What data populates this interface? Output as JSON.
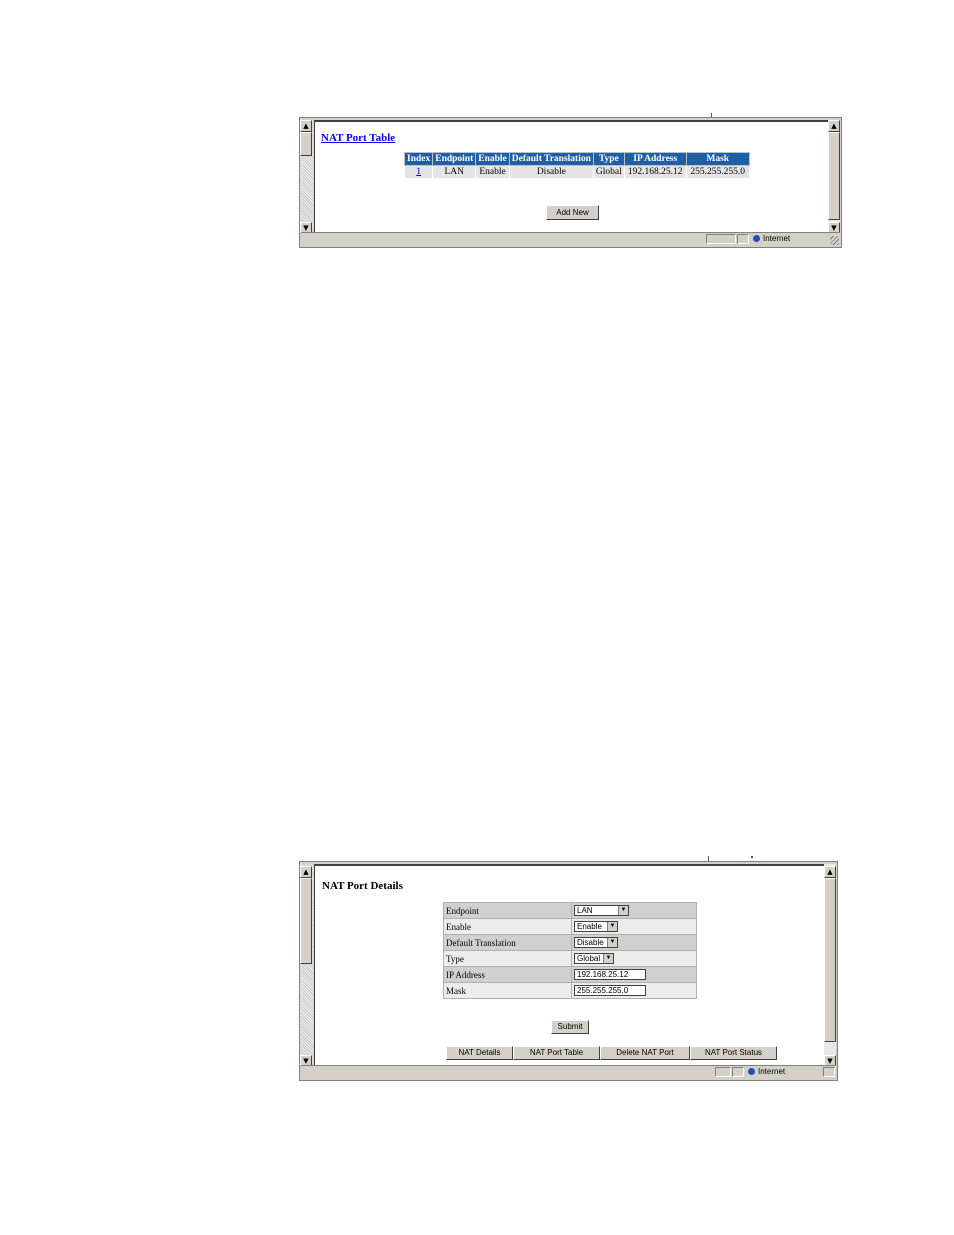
{
  "port_table": {
    "title": "NAT Port Table",
    "columns": [
      "Index",
      "Endpoint",
      "Enable",
      "Default Translation",
      "Type",
      "IP Address",
      "Mask"
    ],
    "rows": [
      {
        "index": "1",
        "endpoint": "LAN",
        "enable": "Enable",
        "default_translation": "Disable",
        "type": "Global",
        "ip_address": "192.168.25.12",
        "mask": "255.255.255.0"
      }
    ],
    "add_new_label": "Add New",
    "status_zone": "Internet"
  },
  "port_details": {
    "title": "NAT Port Details",
    "fields": {
      "endpoint": {
        "label": "Endpoint",
        "value": "LAN"
      },
      "enable": {
        "label": "Enable",
        "value": "Enable"
      },
      "default_translation": {
        "label": "Default Translation",
        "value": "Disable"
      },
      "type": {
        "label": "Type",
        "value": "Global"
      },
      "ip_address": {
        "label": "IP Address",
        "value": "192.168.25.12"
      },
      "mask": {
        "label": "Mask",
        "value": "255.255.255.0"
      }
    },
    "submit_label": "Submit",
    "nav": {
      "nat_details": "NAT Details",
      "nat_port_table": "NAT Port Table",
      "delete_nat_port": "Delete NAT Port",
      "nat_port_status": "NAT Port Status"
    },
    "status_zone": "Internet"
  },
  "colors": {
    "header_blue": "#1f5fa6",
    "link": "#0000ee",
    "chrome": "#d4d0c8"
  },
  "icons": [
    "scroll-up-arrow-icon",
    "scroll-down-arrow-icon",
    "internet-globe-icon",
    "resize-grip-icon",
    "dropdown-arrow-icon"
  ]
}
